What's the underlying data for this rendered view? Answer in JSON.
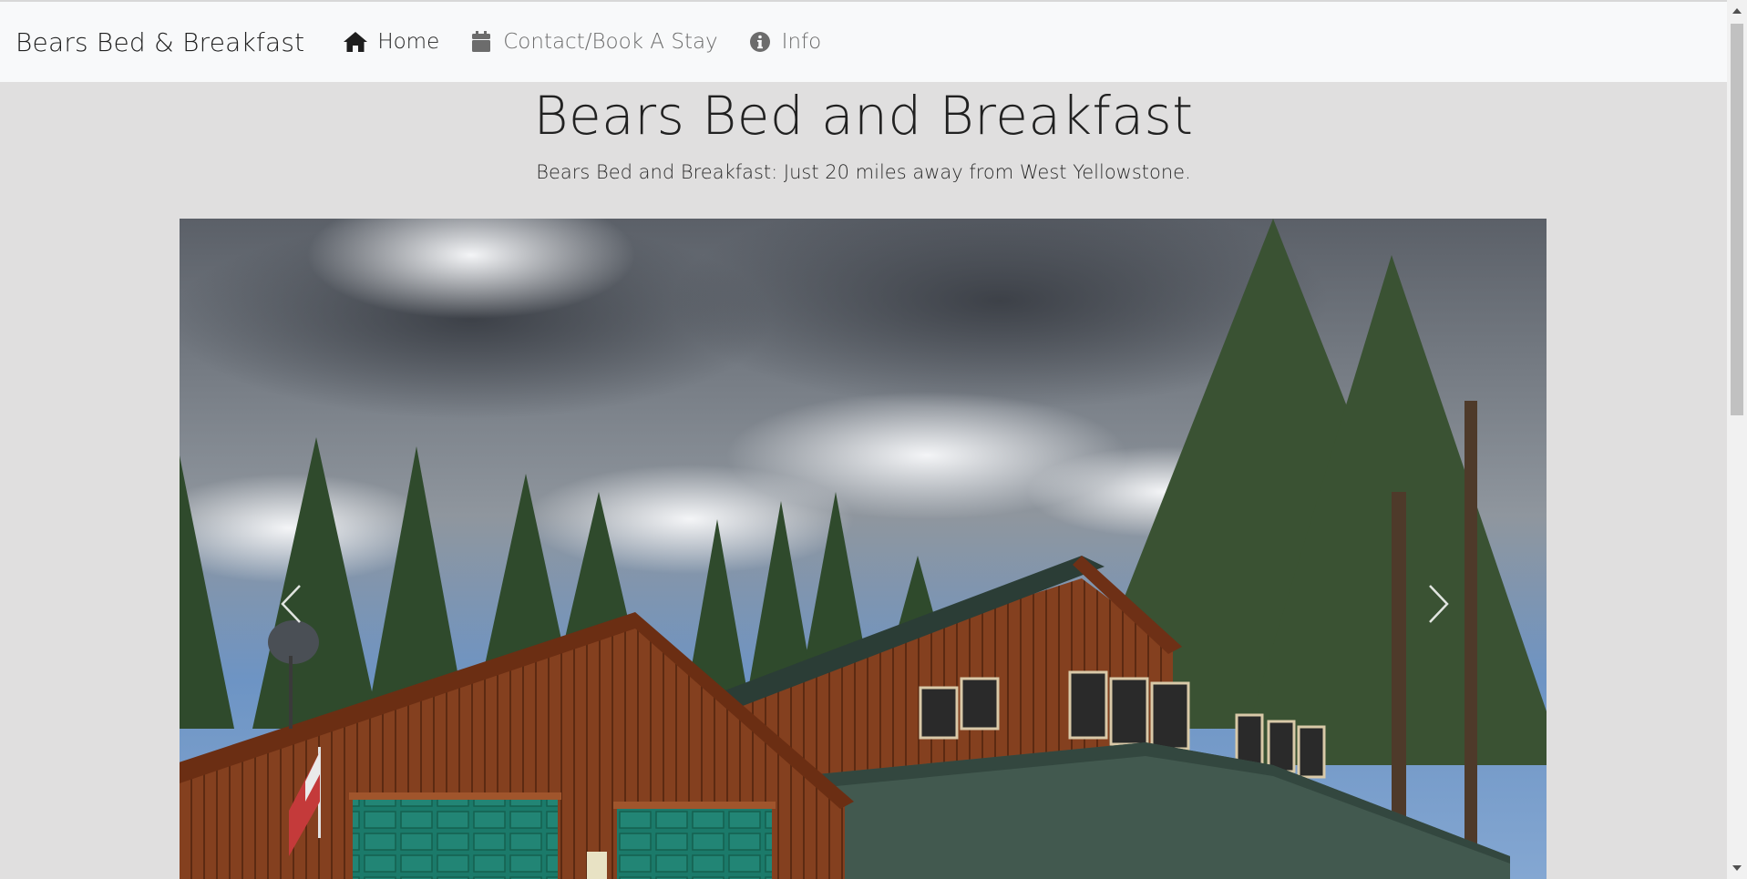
{
  "navbar": {
    "brand": "Bears Bed & Breakfast",
    "items": [
      {
        "label": "Home",
        "icon": "home-icon",
        "active": true
      },
      {
        "label": "Contact/Book A Stay",
        "icon": "calendar-icon",
        "active": false
      },
      {
        "label": "Info",
        "icon": "info-circle-icon",
        "active": false
      }
    ]
  },
  "header": {
    "title": "Bears Bed and Breakfast",
    "subtitle": "Bears Bed and Breakfast: Just 20 miles away from West Yellowstone."
  },
  "carousel": {
    "image": "photo of wooden lodge with garage under cloudy sky and pine trees",
    "prev_icon": "chevron-left-icon",
    "next_icon": "chevron-right-icon"
  },
  "colors": {
    "page_background": "#e0dfdf",
    "navbar_background": "#f8f9fa",
    "text_dark": "#212121",
    "nav_muted": "#6c6c6c"
  }
}
